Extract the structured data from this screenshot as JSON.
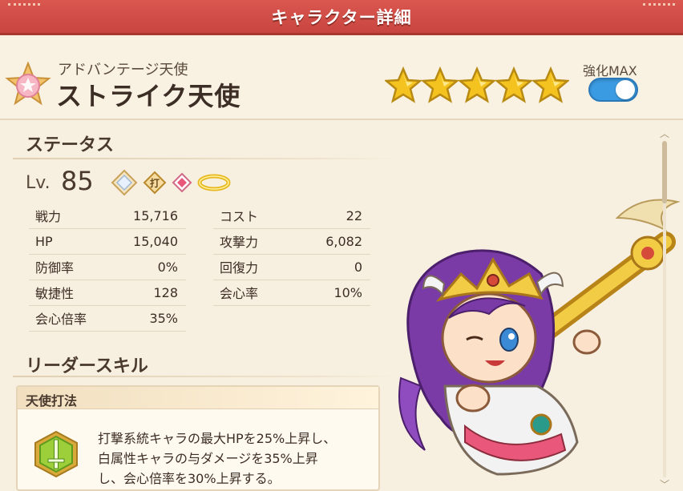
{
  "header": {
    "title": "キャラクター詳細"
  },
  "character": {
    "subtitle": "アドバンテージ天使",
    "name": "ストライク天使",
    "stars": 5,
    "enhance_label": "強化MAX",
    "enhance_on": true
  },
  "status": {
    "title": "ステータス",
    "lv_label": "Lv.",
    "lv_value": "85",
    "badge_attack_type": "打",
    "left": [
      {
        "label": "戦力",
        "value": "15,716"
      },
      {
        "label": "HP",
        "value": "15,040"
      },
      {
        "label": "防御率",
        "value": "0%"
      },
      {
        "label": "敏捷性",
        "value": "128"
      },
      {
        "label": "会心倍率",
        "value": "35%"
      }
    ],
    "right": [
      {
        "label": "コスト",
        "value": "22"
      },
      {
        "label": "攻撃力",
        "value": "6,082"
      },
      {
        "label": "回復力",
        "value": "0"
      },
      {
        "label": "会心率",
        "value": "10%"
      }
    ]
  },
  "leader_skill": {
    "title": "リーダースキル",
    "name": "天使打法",
    "description_lines": [
      "打撃系統キャラの最大HPを25%上昇し、",
      "白属性キャラの与ダメージを35%上昇",
      "し、会心倍率を30%上昇する。"
    ]
  },
  "colors": {
    "header_red": "#d9574f",
    "toggle_blue": "#3b9be2",
    "star_gold": "#f5c320",
    "background": "#f7efdf"
  },
  "icons": {
    "rank": "pink-star-badge-icon",
    "star": "gold-star-icon",
    "element": "white-element-icon",
    "attack_type": "strike-type-icon",
    "gem": "pink-gem-icon",
    "halo": "halo-icon",
    "skill": "green-sword-emblem-icon",
    "scroll_up": "scroll-up-icon",
    "scroll_down": "scroll-down-icon"
  }
}
